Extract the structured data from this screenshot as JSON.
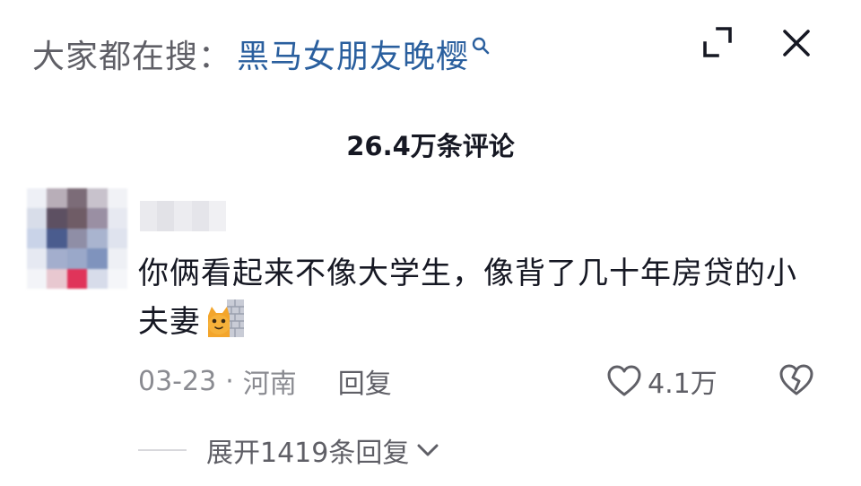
{
  "search": {
    "prefix": "大家都在搜：",
    "term": "黑马女朋友晚樱"
  },
  "comments_header": {
    "title": "26.4万条评论"
  },
  "comment": {
    "text": "你俩看起来不像大学生，像背了几十年房贷的小夫妻",
    "emoji": "cat-peeking-wall-icon",
    "date": "03-23",
    "separator": "·",
    "location": "河南",
    "reply_label": "回复",
    "like_count": "4.1万",
    "expand_replies_label": "展开1419条回复"
  },
  "colors": {
    "search_term": "#2a5f9e",
    "primary_text": "#161823",
    "secondary_text": "#8a8b91",
    "icon": "#161823"
  },
  "icons": {
    "search": "search-icon",
    "expand": "expand-icon",
    "close": "close-icon",
    "like": "heart-icon",
    "dislike": "broken-heart-icon",
    "chevron": "chevron-down-icon"
  }
}
